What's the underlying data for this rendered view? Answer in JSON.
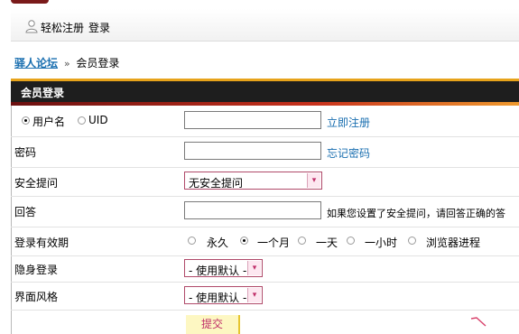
{
  "topbar": {
    "register": "轻松注册",
    "login": "登录"
  },
  "breadcrumb": {
    "home": "驿人论坛",
    "separator": "»",
    "current": "会员登录"
  },
  "form": {
    "title": "会员登录",
    "id_type": {
      "options": [
        "用户名",
        "UID"
      ],
      "selected": "用户名"
    },
    "username": {
      "value": "",
      "link": "立即注册"
    },
    "password": {
      "label": "密码",
      "value": "",
      "link": "忘记密码"
    },
    "security_question": {
      "label": "安全提问",
      "selected": "无安全提问"
    },
    "answer": {
      "label": "回答",
      "value": "",
      "note": "如果您设置了安全提问，请回答正确的答"
    },
    "validity": {
      "label": "登录有效期",
      "options": [
        "永久",
        "一个月",
        "一天",
        "一小时",
        "浏览器进程"
      ],
      "selected": "一个月"
    },
    "invisible": {
      "label": "隐身登录",
      "selected": "- 使用默认 -"
    },
    "style": {
      "label": "界面风格",
      "selected": "- 使用默认 -"
    },
    "submit": "提交"
  },
  "colors": {
    "header_bg": "#1e1e1e",
    "header_top": "#e7a31b",
    "link": "#1a6fb0",
    "select_border": "#b04a6a"
  }
}
